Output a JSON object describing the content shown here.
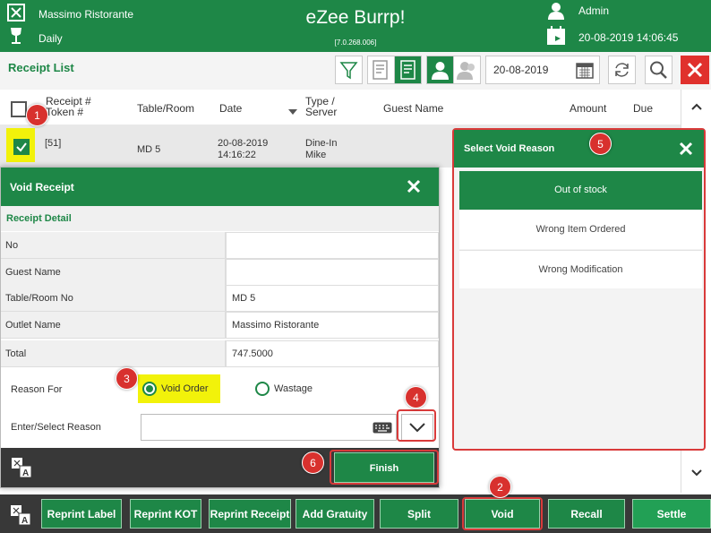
{
  "header": {
    "restaurant": "Massimo Ristorante",
    "mode": "Daily",
    "app_title": "eZee Burrp!",
    "version": "[7.0.268.006]",
    "user": "Admin",
    "datetime": "20-08-2019 14:06:45"
  },
  "toolbar": {
    "title": "Receipt List",
    "date": "20-08-2019"
  },
  "table": {
    "columns": [
      "Receipt #\nToken #",
      "Table/Room",
      "Date",
      "Type /\nServer",
      "Guest Name",
      "Amount",
      "Due"
    ],
    "col_receipt_1": "Receipt #",
    "col_receipt_2": "Token #",
    "col_table": "Table/Room",
    "col_date": "Date",
    "col_type_1": "Type /",
    "col_type_2": "Server",
    "col_guest": "Guest Name",
    "col_amount": "Amount",
    "col_due": "Due",
    "row": {
      "receipt": "[51]",
      "table": "MD 5",
      "date_1": "20-08-2019",
      "date_2": "14:16:22",
      "type_1": "Dine-In",
      "type_2": "Mike"
    }
  },
  "void_dialog": {
    "title": "Void Receipt",
    "section": "Receipt Detail",
    "fields": [
      {
        "label": "No",
        "value": ""
      },
      {
        "label": "Guest Name",
        "value": ""
      },
      {
        "label": "Table/Room No",
        "value": "MD 5"
      },
      {
        "label": "Outlet Name",
        "value": "Massimo Ristorante"
      },
      {
        "label": "Total",
        "value": "747.5000"
      }
    ],
    "reason_for_label": "Reason For",
    "option_void": "Void Order",
    "option_wastage": "Wastage",
    "selected_option": "Void Order",
    "reason_label": "Enter/Select Reason",
    "reason_value": "",
    "finish": "Finish"
  },
  "void_reason": {
    "title": "Select Void Reason",
    "items": [
      "Out of stock",
      "Wrong Item Ordered",
      "Wrong Modification"
    ],
    "selected": "Out of stock"
  },
  "bottom_buttons": [
    "Reprint Label",
    "Reprint KOT",
    "Reprint Receipt",
    "Add Gratuity",
    "Split",
    "Void",
    "Recall",
    "Settle"
  ],
  "badges": [
    "1",
    "2",
    "3",
    "4",
    "5",
    "6"
  ],
  "colors": {
    "brand": "#1e8747",
    "highlight": "#d93a3a",
    "selection_yellow": "#f2f20a",
    "close_red": "#e0312d"
  }
}
